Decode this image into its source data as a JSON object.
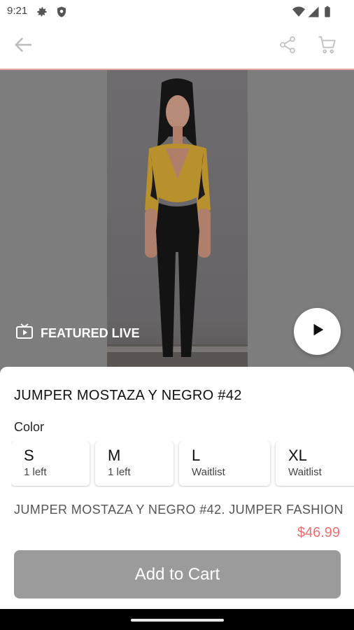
{
  "status_bar": {
    "time": "9:21",
    "icons": [
      "settings-gear-icon",
      "shield-icon",
      "wifi-icon",
      "signal-icon",
      "battery-icon"
    ]
  },
  "app_bar": {
    "back_icon": "arrow-left-icon",
    "share_icon": "share-icon",
    "cart_icon": "cart-icon"
  },
  "hero": {
    "featured_label": "FEATURED LIVE",
    "featured_icon": "tv-icon",
    "play_icon": "play-icon"
  },
  "product": {
    "title": "JUMPER MOSTAZA Y NEGRO #42",
    "option_label": "Color",
    "sizes": [
      {
        "name": "S",
        "stock": "1 left"
      },
      {
        "name": "M",
        "stock": "1 left"
      },
      {
        "name": "L",
        "stock": "Waitlist"
      },
      {
        "name": "XL",
        "stock": "Waitlist"
      }
    ],
    "description": "JUMPER MOSTAZA Y NEGRO #42. JUMPER FASHION",
    "price": "$46.99",
    "add_to_cart_label": "Add to Cart"
  },
  "colors": {
    "accent_divider": "#e8a3a3",
    "price": "#ef6f6f",
    "button_disabled": "#9b9b9b"
  }
}
